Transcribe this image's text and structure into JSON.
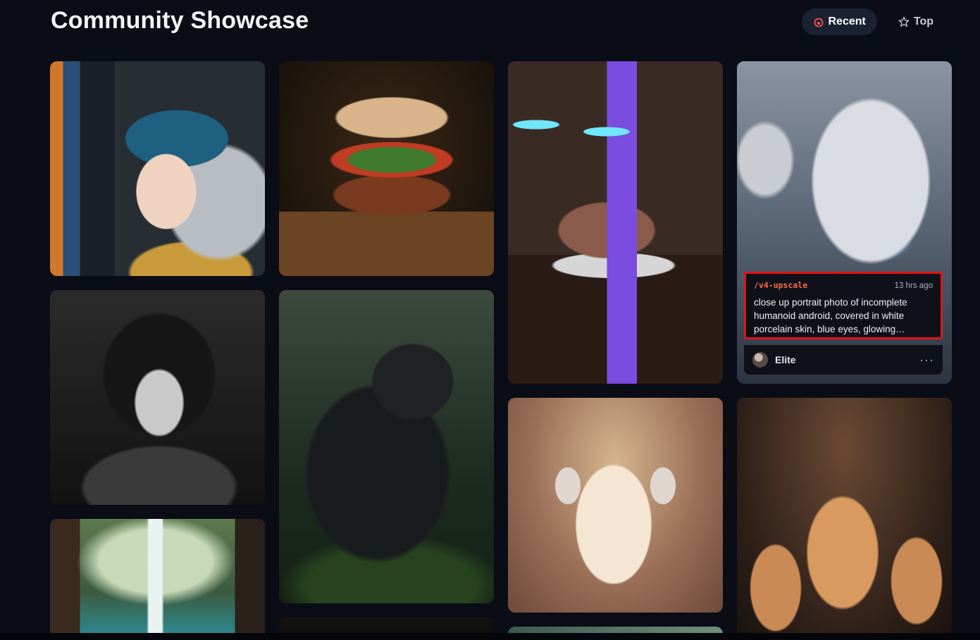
{
  "header": {
    "title": "Community Showcase",
    "sort": [
      {
        "label": "Recent",
        "icon": "flame-icon",
        "active": true
      },
      {
        "label": "Top",
        "icon": "star-icon",
        "active": false
      }
    ]
  },
  "cards": [
    {
      "name": "girl-pearl-earring"
    },
    {
      "name": "sandwich"
    },
    {
      "name": "neon-cake"
    },
    {
      "name": "porcelain-android"
    },
    {
      "name": "goth-girl-portrait"
    },
    {
      "name": "black-panther"
    },
    {
      "name": "headphone-sheep"
    },
    {
      "name": "fox-cubs"
    },
    {
      "name": "jungle-waterfall"
    }
  ],
  "selected_card": {
    "command": "/v4-upscale",
    "time": "13 hrs ago",
    "prompt": "close up portrait photo of incomplete humanoid android, covered in white porcelain skin, blue eyes, glowing…",
    "author": "Elite",
    "more_label": "···"
  },
  "colors": {
    "background": "#0a0c16",
    "active_pill": "#1a2132",
    "command": "#ff6a3d",
    "highlight_border": "#e01414"
  }
}
